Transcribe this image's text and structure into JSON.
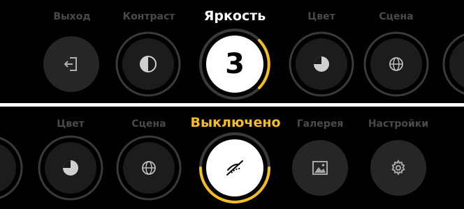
{
  "top_row": {
    "items": [
      {
        "label": "Выход",
        "icon": "exit-icon"
      },
      {
        "label": "Контраст",
        "icon": "contrast-icon"
      },
      {
        "label": "Яркость",
        "value": "3",
        "icon": "brightness-dial",
        "level": 0.3
      },
      {
        "label": "Цвет",
        "icon": "color-icon"
      },
      {
        "label": "Сцена",
        "icon": "globe-icon"
      }
    ]
  },
  "bottom_row": {
    "items": [
      {
        "label": "Цвет",
        "icon": "color-icon"
      },
      {
        "label": "Сцена",
        "icon": "globe-icon"
      },
      {
        "label": "Выключено",
        "icon": "display-off-icon",
        "level": 0.5
      },
      {
        "label": "Галерея",
        "icon": "gallery-icon"
      },
      {
        "label": "Настройки",
        "icon": "settings-gear-icon"
      }
    ]
  },
  "colors": {
    "accent": "#f5be1e",
    "background": "#000000",
    "inactive_fill": "#2a2a2a",
    "ring": "#3a3a3a"
  }
}
